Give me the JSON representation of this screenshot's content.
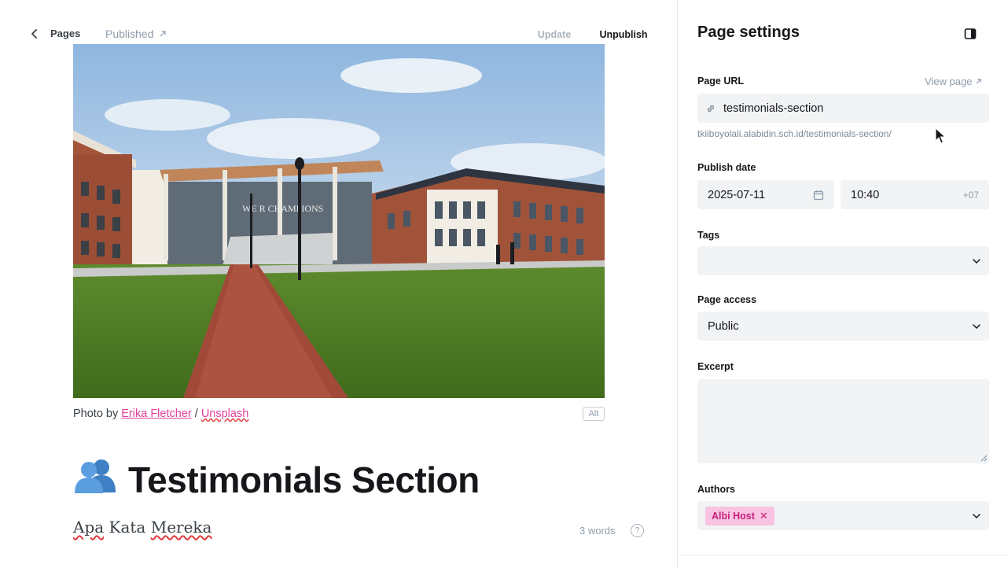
{
  "editor": {
    "breadcrumb": {
      "pages_label": "Pages"
    },
    "status": {
      "label": "Published"
    },
    "actions": {
      "update_label": "Update",
      "unpublish_label": "Unpublish"
    },
    "feature_image": {
      "caption_prefix": "Photo by ",
      "author_link": "Erika Fletcher",
      "separator": " / ",
      "source_link": "Unsplash",
      "alt_label": "Alt",
      "sign_text": "WE R CHAMPIONS"
    },
    "title": "Testimonials Section",
    "title_emoji": "👥",
    "body_text_word1": "Apa",
    "body_text_word2": "Kata",
    "body_text_word3": "Mereka",
    "word_count": "3 words",
    "help_label": "?"
  },
  "settings": {
    "title": "Page settings",
    "page_url": {
      "label": "Page URL",
      "view_page_label": "View page",
      "value": "testimonials-section",
      "full_url": "tkiiboyolali.alabidin.sch.id/testimonials-section/"
    },
    "publish_date": {
      "label": "Publish date",
      "date": "2025-07-11",
      "time": "10:40",
      "timezone": "+07"
    },
    "tags": {
      "label": "Tags",
      "value": ""
    },
    "page_access": {
      "label": "Page access",
      "value": "Public"
    },
    "excerpt": {
      "label": "Excerpt",
      "value": ""
    },
    "authors": {
      "label": "Authors",
      "items": [
        {
          "name": "Albi Host"
        }
      ]
    }
  },
  "colors": {
    "accent_pink": "#e0409a",
    "chip_bg": "#f8c3e0",
    "field_bg": "#f1f3f4",
    "text_dark": "#15171a",
    "text_muted": "#8e9cac"
  }
}
